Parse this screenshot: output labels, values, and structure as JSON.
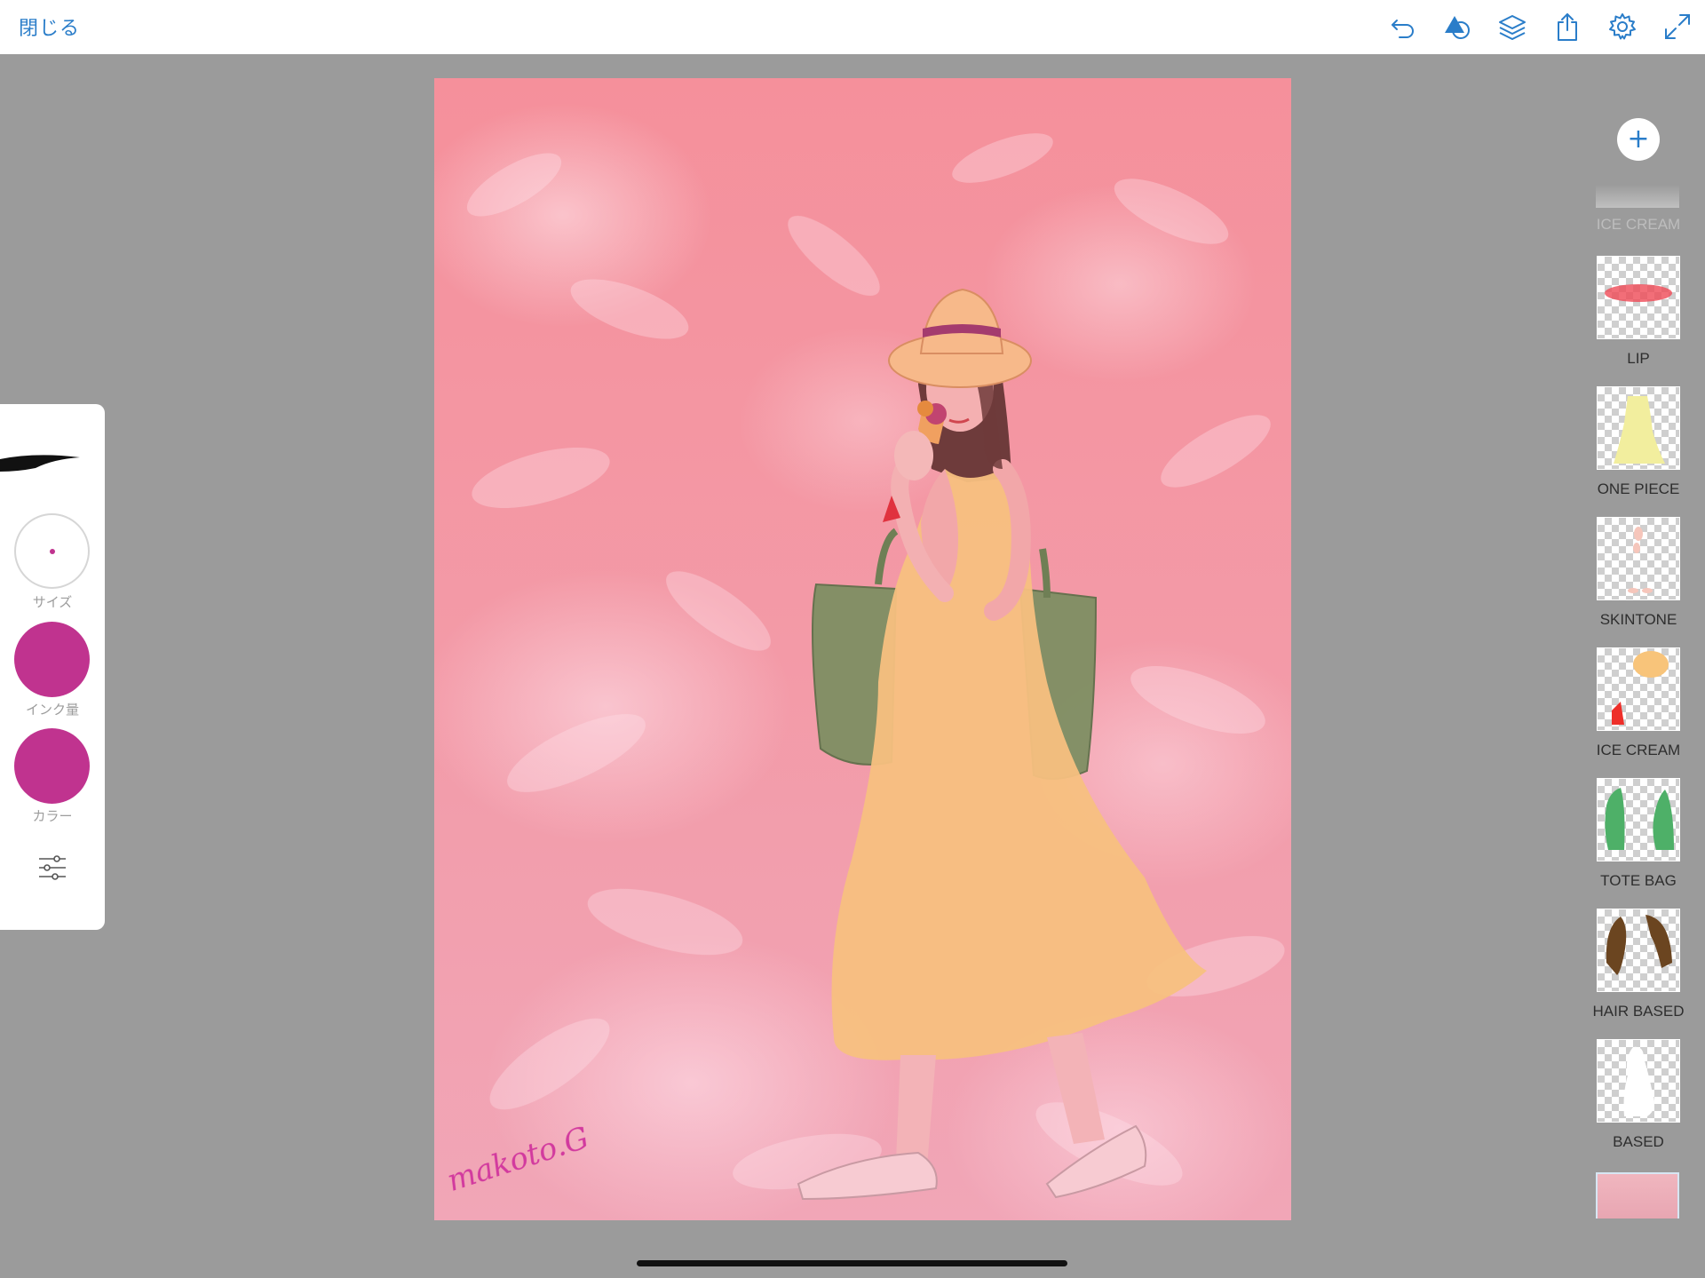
{
  "topbar": {
    "close_label": "閉じる",
    "icons": [
      "undo-icon",
      "shapes-icon",
      "layers-icon",
      "share-icon",
      "settings-icon",
      "fullscreen-icon"
    ]
  },
  "brush_panel": {
    "size_label": "サイズ",
    "ink_label": "インク量",
    "color_label": "カラー",
    "brush_color": "#c0338f"
  },
  "layers": {
    "partial_top_label": "ICE CREAM",
    "items": [
      {
        "label": "LIP"
      },
      {
        "label": "ONE PIECE"
      },
      {
        "label": "SKINTONE"
      },
      {
        "label": "ICE CREAM"
      },
      {
        "label": "TOTE BAG"
      },
      {
        "label": "HAIR BASED"
      },
      {
        "label": "BASED"
      }
    ]
  },
  "canvas": {
    "signature": "makoto.G"
  },
  "colors": {
    "accent": "#2a7dc9",
    "workspace": "#9b9b9b",
    "canvas_pink": "#f5909b"
  }
}
